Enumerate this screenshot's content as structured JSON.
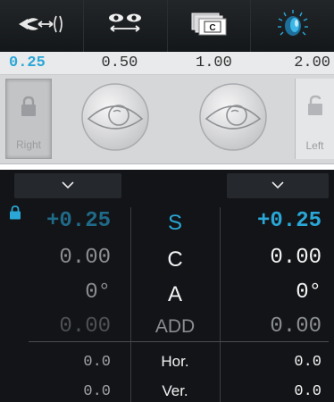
{
  "toolbar": {
    "buttons": [
      {
        "name": "pd-distance-icon"
      },
      {
        "name": "binocular-balance-icon"
      },
      {
        "name": "chart-card-icon",
        "label": "C"
      },
      {
        "name": "dial-icon"
      }
    ]
  },
  "steps": [
    "0.25",
    "0.50",
    "1.00",
    "2.00"
  ],
  "selected_step": "0.25",
  "eyes": {
    "right_label": "Right",
    "left_label": "Left"
  },
  "table": {
    "rows": [
      {
        "label": "S",
        "right": "+0.25",
        "left": "+0.25"
      },
      {
        "label": "C",
        "right": "0.00",
        "left": "0.00"
      },
      {
        "label": "A",
        "right": "0°",
        "left": "0°"
      },
      {
        "label": "ADD",
        "right": "0.00",
        "left": "0.00"
      },
      {
        "label": "Hor.",
        "right": "0.0",
        "left": "0.0"
      },
      {
        "label": "Ver.",
        "right": "0.0",
        "left": "0.0"
      }
    ]
  },
  "colors": {
    "accent": "#2aa7d6",
    "panel_bg": "#121417",
    "toolbar_bg": "#1b1e21"
  }
}
